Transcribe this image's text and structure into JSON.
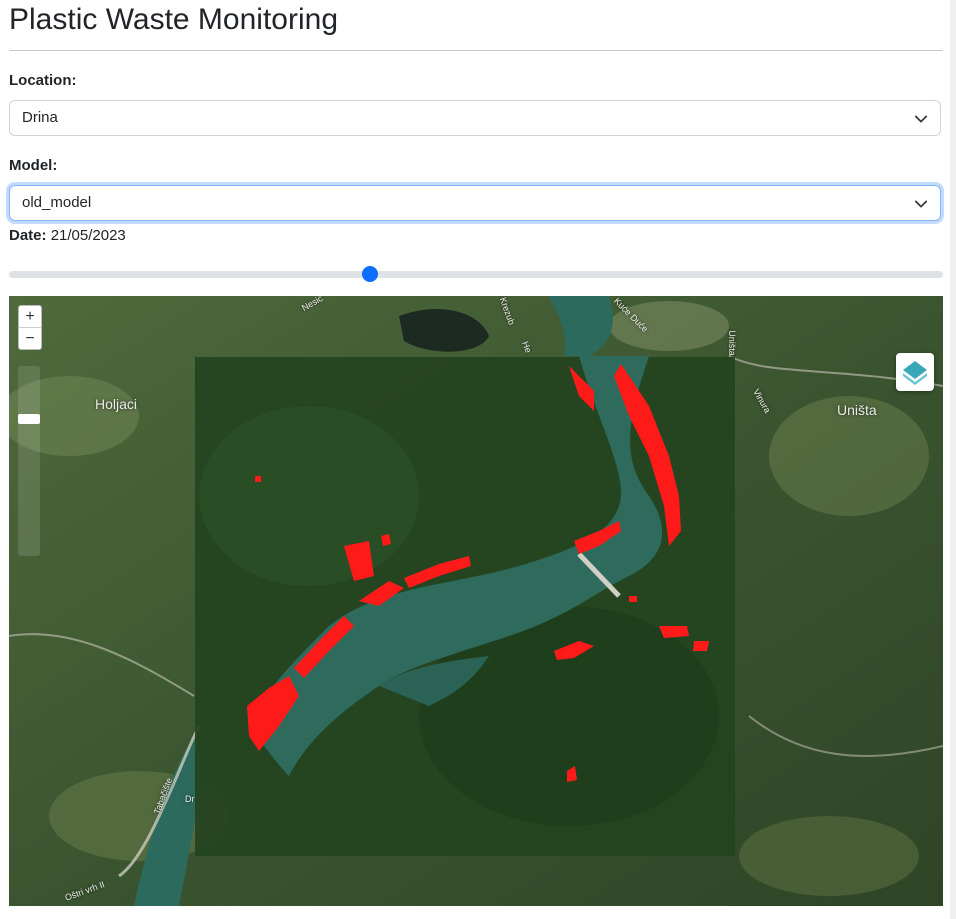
{
  "page": {
    "title": "Plastic Waste Monitoring"
  },
  "form": {
    "location": {
      "label": "Location:",
      "value": "Drina"
    },
    "model": {
      "label": "Model:",
      "value": "old_model"
    },
    "date": {
      "label": "Date:",
      "value": "21/05/2023"
    },
    "slider": {
      "position_fraction": 0.385
    }
  },
  "map": {
    "zoom_in_label": "+",
    "zoom_out_label": "−",
    "place_labels": {
      "holjaci": "Holjaci",
      "unista": "Uništa",
      "unista_road": "Uništa",
      "vinura": "Vinura",
      "tabaciste": "Tabačište",
      "ostri_vrh": "Oštri vrh II",
      "dr": "Dr",
      "he": "He",
      "krezub": "Krezub",
      "nesic": "Nesić",
      "kuce": "Kuće Duće"
    },
    "colors": {
      "detections": "#ff1a1a",
      "water": "#2e6b5d",
      "forest": "#2f4a26"
    },
    "icons": [
      "layers-icon",
      "zoom-in-icon",
      "zoom-out-icon",
      "chevron-down-icon"
    ]
  }
}
